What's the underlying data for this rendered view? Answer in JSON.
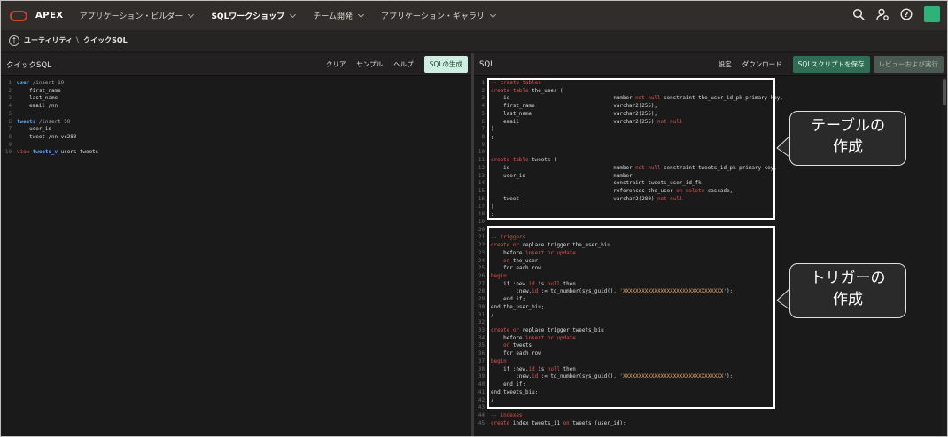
{
  "header": {
    "brand": "APEX",
    "nav": [
      {
        "label": "アプリケーション・ビルダー",
        "active": false
      },
      {
        "label": "SQLワークショップ",
        "active": true
      },
      {
        "label": "チーム開発",
        "active": false
      },
      {
        "label": "アプリケーション・ギャラリ",
        "active": false
      }
    ],
    "icons": [
      "search-icon",
      "user-settings-icon",
      "help-icon"
    ],
    "accent_color": "#2db37a",
    "logo_color": "#c74634"
  },
  "breadcrumb": {
    "items": [
      "ユーティリティ",
      "クイックSQL"
    ],
    "separator": "\\"
  },
  "left_panel": {
    "title": "クイックSQL",
    "actions": {
      "clear": "クリア",
      "sample": "サンプル",
      "help": "ヘルプ",
      "generate": "SQLの生成"
    }
  },
  "right_panel": {
    "title": "SQL",
    "actions": {
      "settings": "設定",
      "download": "ダウンロード",
      "save": "SQLスクリプトを保存",
      "review": "レビューおよび実行"
    }
  },
  "left_code": [
    {
      "n": "1",
      "t": [
        [
          "user",
          "id"
        ],
        [
          " /insert 10",
          "dir"
        ]
      ]
    },
    {
      "n": "2",
      "t": [
        [
          "    first_name",
          "tx"
        ]
      ]
    },
    {
      "n": "3",
      "t": [
        [
          "    last_name",
          "tx"
        ]
      ]
    },
    {
      "n": "4",
      "t": [
        [
          "    email /nn",
          "tx"
        ]
      ]
    },
    {
      "n": "5",
      "t": []
    },
    {
      "n": "6",
      "t": [
        [
          "tweets",
          "id"
        ],
        [
          " /insert 50",
          "dir"
        ]
      ]
    },
    {
      "n": "7",
      "t": [
        [
          "    user_id",
          "tx"
        ]
      ]
    },
    {
      "n": "8",
      "t": [
        [
          "    tweet /nn vc280",
          "tx"
        ]
      ]
    },
    {
      "n": "9",
      "t": []
    },
    {
      "n": "10",
      "t": [
        [
          "view ",
          "kw"
        ],
        [
          "tweets_v",
          "id"
        ],
        [
          " users tweets",
          "tx"
        ]
      ]
    }
  ],
  "right_code": [
    {
      "n": "1",
      "t": [
        [
          "-- create tables",
          "cm"
        ]
      ]
    },
    {
      "n": "2",
      "t": [
        [
          "create table",
          "kw"
        ],
        [
          " the_user (",
          "tx"
        ]
      ]
    },
    {
      "n": "3",
      "t": [
        [
          "    id                                 ",
          "tx"
        ],
        [
          "number ",
          "tx"
        ],
        [
          "not null",
          "kw"
        ],
        [
          " constraint the_user_id_pk primary key,",
          "tx"
        ]
      ]
    },
    {
      "n": "4",
      "t": [
        [
          "    first_name                         varchar2(255),",
          "tx"
        ]
      ]
    },
    {
      "n": "5",
      "t": [
        [
          "    last_name                          varchar2(255),",
          "tx"
        ]
      ]
    },
    {
      "n": "6",
      "t": [
        [
          "    email                              varchar2(255) ",
          "tx"
        ],
        [
          "not null",
          "kw"
        ]
      ]
    },
    {
      "n": "7",
      "t": [
        [
          ")",
          "tx"
        ]
      ]
    },
    {
      "n": "8",
      "t": [
        [
          ";",
          "tx"
        ]
      ]
    },
    {
      "n": "9",
      "t": []
    },
    {
      "n": "10",
      "t": []
    },
    {
      "n": "11",
      "t": [
        [
          "create table",
          "kw"
        ],
        [
          " tweets (",
          "tx"
        ]
      ]
    },
    {
      "n": "12",
      "t": [
        [
          "    id                                 number ",
          "tx"
        ],
        [
          "not null",
          "kw"
        ],
        [
          " constraint tweets_id_pk primary key,",
          "tx"
        ]
      ]
    },
    {
      "n": "13",
      "t": [
        [
          "    user_id                            number",
          "tx"
        ]
      ]
    },
    {
      "n": "14",
      "t": [
        [
          "                                       constraint tweets_user_id_fk",
          "tx"
        ]
      ]
    },
    {
      "n": "15",
      "t": [
        [
          "                                       references the_user ",
          "tx"
        ],
        [
          "on delete",
          "kw"
        ],
        [
          " cascade,",
          "tx"
        ]
      ]
    },
    {
      "n": "16",
      "t": [
        [
          "    tweet                              varchar2(280) ",
          "tx"
        ],
        [
          "not null",
          "kw"
        ]
      ]
    },
    {
      "n": "17",
      "t": [
        [
          ")",
          "tx"
        ]
      ]
    },
    {
      "n": "18",
      "t": [
        [
          ";",
          "tx"
        ]
      ]
    },
    {
      "n": "19",
      "t": []
    },
    {
      "n": "20",
      "t": []
    },
    {
      "n": "21",
      "t": [
        [
          "-- triggers",
          "cm"
        ]
      ]
    },
    {
      "n": "22",
      "t": [
        [
          "create or",
          "kw"
        ],
        [
          " replace trigger the_user_biu",
          "tx"
        ]
      ]
    },
    {
      "n": "23",
      "t": [
        [
          "    before ",
          "tx"
        ],
        [
          "insert or update",
          "kw"
        ]
      ]
    },
    {
      "n": "24",
      "t": [
        [
          "    on",
          "kw"
        ],
        [
          " the_user",
          "tx"
        ]
      ]
    },
    {
      "n": "25",
      "t": [
        [
          "    for each row",
          "tx"
        ]
      ]
    },
    {
      "n": "26",
      "t": [
        [
          "begin",
          "kw"
        ]
      ]
    },
    {
      "n": "27",
      "t": [
        [
          "    if :new.",
          "tx"
        ],
        [
          "id",
          "kw"
        ],
        [
          " is ",
          "tx"
        ],
        [
          "null",
          "kw"
        ],
        [
          " then",
          "tx"
        ]
      ]
    },
    {
      "n": "28",
      "t": [
        [
          "        :new.",
          "tx"
        ],
        [
          "id",
          "kw"
        ],
        [
          " := to_number(sys_guid(), ",
          "tx"
        ],
        [
          "'XXXXXXXXXXXXXXXXXXXXXXXXXXXXXXXX'",
          "str"
        ],
        [
          ");",
          "tx"
        ]
      ]
    },
    {
      "n": "29",
      "t": [
        [
          "    end if;",
          "tx"
        ]
      ]
    },
    {
      "n": "30",
      "t": [
        [
          "end the_user_biu;",
          "tx"
        ]
      ]
    },
    {
      "n": "31",
      "t": [
        [
          "/",
          "tx"
        ]
      ]
    },
    {
      "n": "32",
      "t": []
    },
    {
      "n": "33",
      "t": [
        [
          "create or",
          "kw"
        ],
        [
          " replace trigger tweets_biu",
          "tx"
        ]
      ]
    },
    {
      "n": "34",
      "t": [
        [
          "    before ",
          "tx"
        ],
        [
          "insert or update",
          "kw"
        ]
      ]
    },
    {
      "n": "35",
      "t": [
        [
          "    on",
          "kw"
        ],
        [
          " tweets",
          "tx"
        ]
      ]
    },
    {
      "n": "36",
      "t": [
        [
          "    for each row",
          "tx"
        ]
      ]
    },
    {
      "n": "37",
      "t": [
        [
          "begin",
          "kw"
        ]
      ]
    },
    {
      "n": "38",
      "t": [
        [
          "    if :new.",
          "tx"
        ],
        [
          "id",
          "kw"
        ],
        [
          " is ",
          "tx"
        ],
        [
          "null",
          "kw"
        ],
        [
          " then",
          "tx"
        ]
      ]
    },
    {
      "n": "39",
      "t": [
        [
          "        :new.",
          "tx"
        ],
        [
          "id",
          "kw"
        ],
        [
          " := to_number(sys_guid(), ",
          "tx"
        ],
        [
          "'XXXXXXXXXXXXXXXXXXXXXXXXXXXXXXXX'",
          "str"
        ],
        [
          ");",
          "tx"
        ]
      ]
    },
    {
      "n": "40",
      "t": [
        [
          "    end if;",
          "tx"
        ]
      ]
    },
    {
      "n": "41",
      "t": [
        [
          "end tweets_biu;",
          "tx"
        ]
      ]
    },
    {
      "n": "42",
      "t": [
        [
          "/",
          "tx"
        ]
      ]
    },
    {
      "n": "43",
      "t": []
    },
    {
      "n": "44",
      "t": [
        [
          "-- indexes",
          "cm"
        ]
      ]
    },
    {
      "n": "45",
      "t": [
        [
          "create",
          "kw"
        ],
        [
          " index tweets_i1 ",
          "tx"
        ],
        [
          "on",
          "kw"
        ],
        [
          " tweets (user_id);",
          "tx"
        ]
      ]
    }
  ],
  "callouts": {
    "table": {
      "line1": "テーブルの",
      "line2": "作成"
    },
    "trigger": {
      "line1": "トリガーの",
      "line2": "作成"
    }
  }
}
